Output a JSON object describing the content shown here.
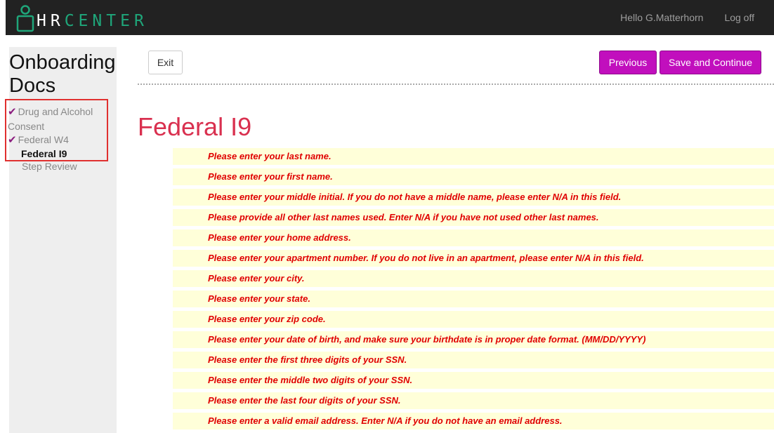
{
  "header": {
    "logo_hr": "HR",
    "logo_center": "CENTER",
    "greeting": "Hello G.Matterhorn",
    "logoff": "Log off"
  },
  "sidebar": {
    "title": "Onboarding Docs",
    "items": [
      {
        "label": "Drug and Alcohol Consent",
        "done": true
      },
      {
        "label": "Federal W4",
        "done": true
      },
      {
        "label": "Federal I9",
        "active": true
      },
      {
        "label": "Step Review"
      }
    ]
  },
  "toolbar": {
    "exit": "Exit",
    "previous": "Previous",
    "save_continue": "Save and Continue"
  },
  "page": {
    "title": "Federal I9"
  },
  "errors": [
    "Please enter your last name.",
    "Please enter your first name.",
    "Please enter your middle initial. If you do not have a middle name, please enter N/A in this field.",
    "Please provide all other last names used. Enter N/A if you have not used other last names.",
    "Please enter your home address.",
    "Please enter your apartment number. If you do not live in an apartment, please enter N/A in this field.",
    "Please enter your city.",
    "Please enter your state.",
    "Please enter your zip code.",
    "Please enter your date of birth, and make sure your birthdate is in proper date format. (MM/DD/YYYY)",
    "Please enter the first three digits of your SSN.",
    "Please enter the middle two digits of your SSN.",
    "Please enter the last four digits of your SSN.",
    "Please enter a valid email address. Enter N/A if you do not have an email address."
  ],
  "colors": {
    "accent": "#c10fbd",
    "title": "#d9304f",
    "error_text": "#e00000",
    "error_bg": "#ffffd9",
    "logo_green": "#1fa67a"
  }
}
